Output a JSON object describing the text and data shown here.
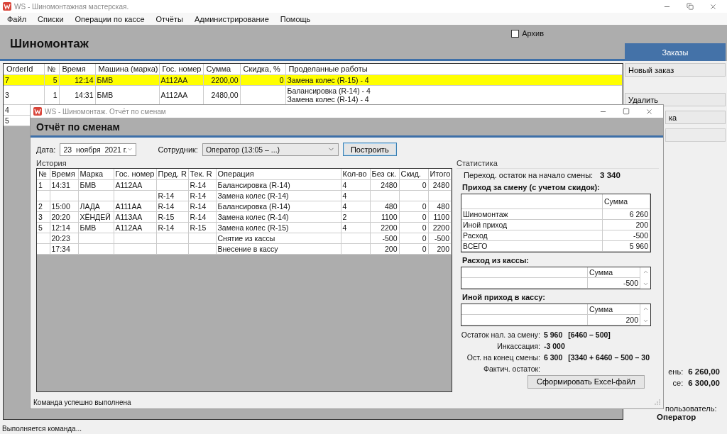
{
  "window": {
    "title": "WS - Шиномонтажная мастерская."
  },
  "menu": [
    "Файл",
    "Списки",
    "Операции по кассе",
    "Отчёты",
    "Администрирование",
    "Помощь"
  ],
  "header": {
    "title": "Шиномонтаж",
    "archive": {
      "label": "Архив",
      "checked": false
    }
  },
  "orders": {
    "columns": [
      "OrderId",
      "№",
      "Время",
      "Машина (марка)",
      "Гос. номер",
      "Сумма",
      "Скидка, %",
      "Проделанные работы"
    ],
    "rows": [
      {
        "selected": true,
        "cells": [
          "7",
          "5",
          "12:14",
          "БМВ",
          "А112АА",
          "2200,00",
          "0",
          "Замена колес (R-15) - 4"
        ]
      },
      {
        "selected": false,
        "cells": [
          "3",
          "1",
          "14:31",
          "БМВ",
          "А112АА",
          "2480,00",
          null,
          "Балансировка (R-14) - 4\nЗамена колес (R-14) - 4"
        ]
      },
      {
        "selected": false,
        "cells": [
          "4"
        ]
      },
      {
        "selected": false,
        "cells": [
          "5"
        ]
      }
    ]
  },
  "side": {
    "tab": "Заказы",
    "buttons": [
      {
        "label": "Новый заказ"
      },
      {
        "label": "Удалить"
      },
      {
        "label": "ка"
      },
      {
        "kind": "blank"
      }
    ]
  },
  "summary": [
    {
      "label": "ень:",
      "value": "6 260,00"
    },
    {
      "label": "се:",
      "value": "6 300,00"
    }
  ],
  "user": {
    "label": "пользователь:",
    "name": "Оператор"
  },
  "status_bar": "Выполняется команда...",
  "dialog": {
    "title": "WS - Шиномонтаж. Отчёт по сменам",
    "heading": "Отчёт по сменам",
    "date": {
      "label": "Дата:",
      "value": "23  ноября  2021 г."
    },
    "employee": {
      "label": "Сотрудник:",
      "value": "Оператор (13:05 – ...)"
    },
    "build_button": "Построить",
    "history": {
      "label": "История",
      "columns": [
        "№",
        "Время",
        "Марка",
        "Гос. номер",
        "Пред. R",
        "Тек. R",
        "Операция",
        "Кол-во",
        "Без ск.",
        "Скид.",
        "Итого"
      ],
      "rows": [
        [
          "1",
          "14:31",
          "БМВ",
          "А112АА",
          null,
          "R-14",
          "Балансировка (R-14)",
          "4",
          "2480",
          "0",
          "2480"
        ],
        [
          null,
          null,
          null,
          null,
          "R-14",
          "R-14",
          "Замена колес (R-14)",
          "4",
          null,
          null,
          null
        ],
        [
          "2",
          "15:00",
          "ЛАДА",
          "А111АА",
          "R-14",
          "R-14",
          "Балансировка (R-14)",
          "4",
          "480",
          "0",
          "480"
        ],
        [
          "3",
          "20:20",
          "ХЁНДЕЙ",
          "А113АА",
          "R-15",
          "R-14",
          "Замена колес (R-14)",
          "2",
          "1100",
          "0",
          "1100"
        ],
        [
          "5",
          "12:14",
          "БМВ",
          "А112АА",
          "R-14",
          "R-15",
          "Замена колес (R-15)",
          "4",
          "2200",
          "0",
          "2200"
        ],
        [
          null,
          "20:23",
          null,
          null,
          null,
          null,
          "Снятие из кассы",
          null,
          "-500",
          "0",
          "-500"
        ],
        [
          null,
          "17:34",
          null,
          null,
          null,
          null,
          "Внесение в кассу",
          null,
          "200",
          "0",
          "200"
        ]
      ]
    },
    "stats": {
      "label": "Статистика",
      "carry": {
        "label": "Переход. остаток на начало смены:",
        "value": "3 340"
      },
      "income": {
        "heading": "Приход за смену (с учетом скидок):",
        "column": "Сумма",
        "rows": [
          {
            "name": "Шиномонтаж",
            "value": "6 260"
          },
          {
            "name": "Иной приход",
            "value": "200"
          },
          {
            "name": "Расход",
            "value": "-500"
          },
          {
            "name": "ВСЕГО",
            "value": "5 960"
          }
        ]
      },
      "expense": {
        "heading": "Расход из кассы:",
        "column": "Сумма",
        "values": [
          "-500"
        ]
      },
      "other_income": {
        "heading": "Иной приход в кассу:",
        "column": "Сумма",
        "values": [
          "200"
        ]
      },
      "totals": [
        {
          "label": "Остаток нал. за смену:",
          "value": "5 960",
          "note": "[6460 – 500]"
        },
        {
          "label": "Инкассация:",
          "value": "-3 000"
        },
        {
          "label": "Ост. на конец смены:",
          "value": "6 300",
          "note": "[3340 + 6460 – 500 – 30"
        },
        {
          "label": "Фактич. остаток:"
        }
      ],
      "excel_button": "Сформировать Excel-файл"
    },
    "status": "Команда успешно выполнена"
  }
}
